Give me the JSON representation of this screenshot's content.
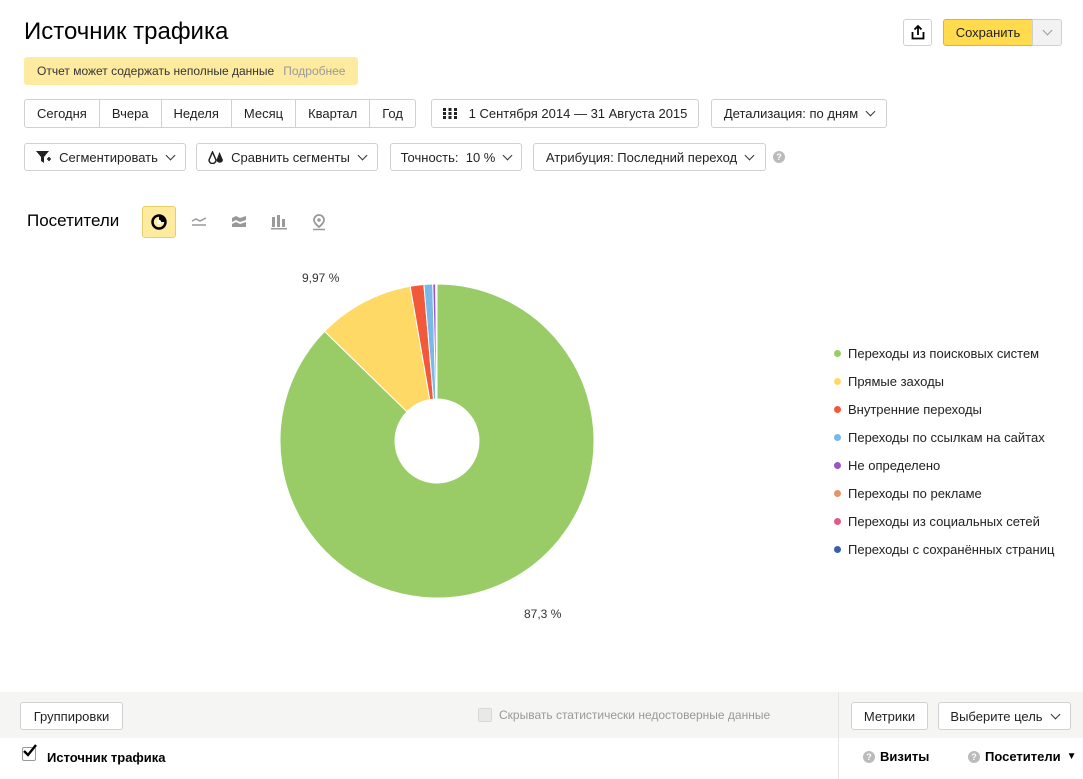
{
  "header": {
    "title": "Источник трафика",
    "save_label": "Сохранить",
    "share_icon": "share-icon"
  },
  "warning": {
    "text": "Отчет может содержать неполные данные",
    "link": "Подробнее"
  },
  "periods": [
    "Сегодня",
    "Вчера",
    "Неделя",
    "Месяц",
    "Квартал",
    "Год"
  ],
  "date_range": "1 Сентября 2014 — 31 Августа 2015",
  "detail": "Детализация: по дням",
  "filters": {
    "segment": "Сегментировать",
    "compare": "Сравнить сегменты",
    "accuracy": "Точность:  10 %",
    "attribution": "Атрибуция: Последний переход"
  },
  "viz": {
    "title": "Посетители",
    "modes": [
      "pie-chart-icon",
      "line-chart-icon",
      "area-chart-icon",
      "bar-chart-icon",
      "map-icon"
    ],
    "active_mode": "pie-chart-icon"
  },
  "chart_data": {
    "type": "pie",
    "donut": true,
    "labels": [
      "Переходы из поисковых систем",
      "Прямые заходы",
      "Внутренние переходы",
      "Переходы по ссылкам на сайтах",
      "Не определено",
      "Переходы по рекламе",
      "Переходы из социальных сетей",
      "Переходы с сохранённых страниц"
    ],
    "values": [
      87.3,
      9.97,
      1.4,
      0.9,
      0.3,
      0.1,
      0.02,
      0.01
    ],
    "colors": [
      "#99cc66",
      "#ffd966",
      "#f2583a",
      "#7ab8e8",
      "#9955cc",
      "#e0956a",
      "#e05a8a",
      "#3d5fa8"
    ],
    "data_labels": [
      "87,3 %",
      "9,97 %"
    ],
    "legend_position": "right"
  },
  "bottom": {
    "groupings": "Группировки",
    "hide_unreliable": "Скрывать статистически недостоверные данные",
    "metrics": "Метрики",
    "goal": "Выберите цель",
    "row_label": "Источник трафика",
    "col_visits": "Визиты",
    "col_visitors": "Посетители",
    "sort_indicator": "▼"
  }
}
